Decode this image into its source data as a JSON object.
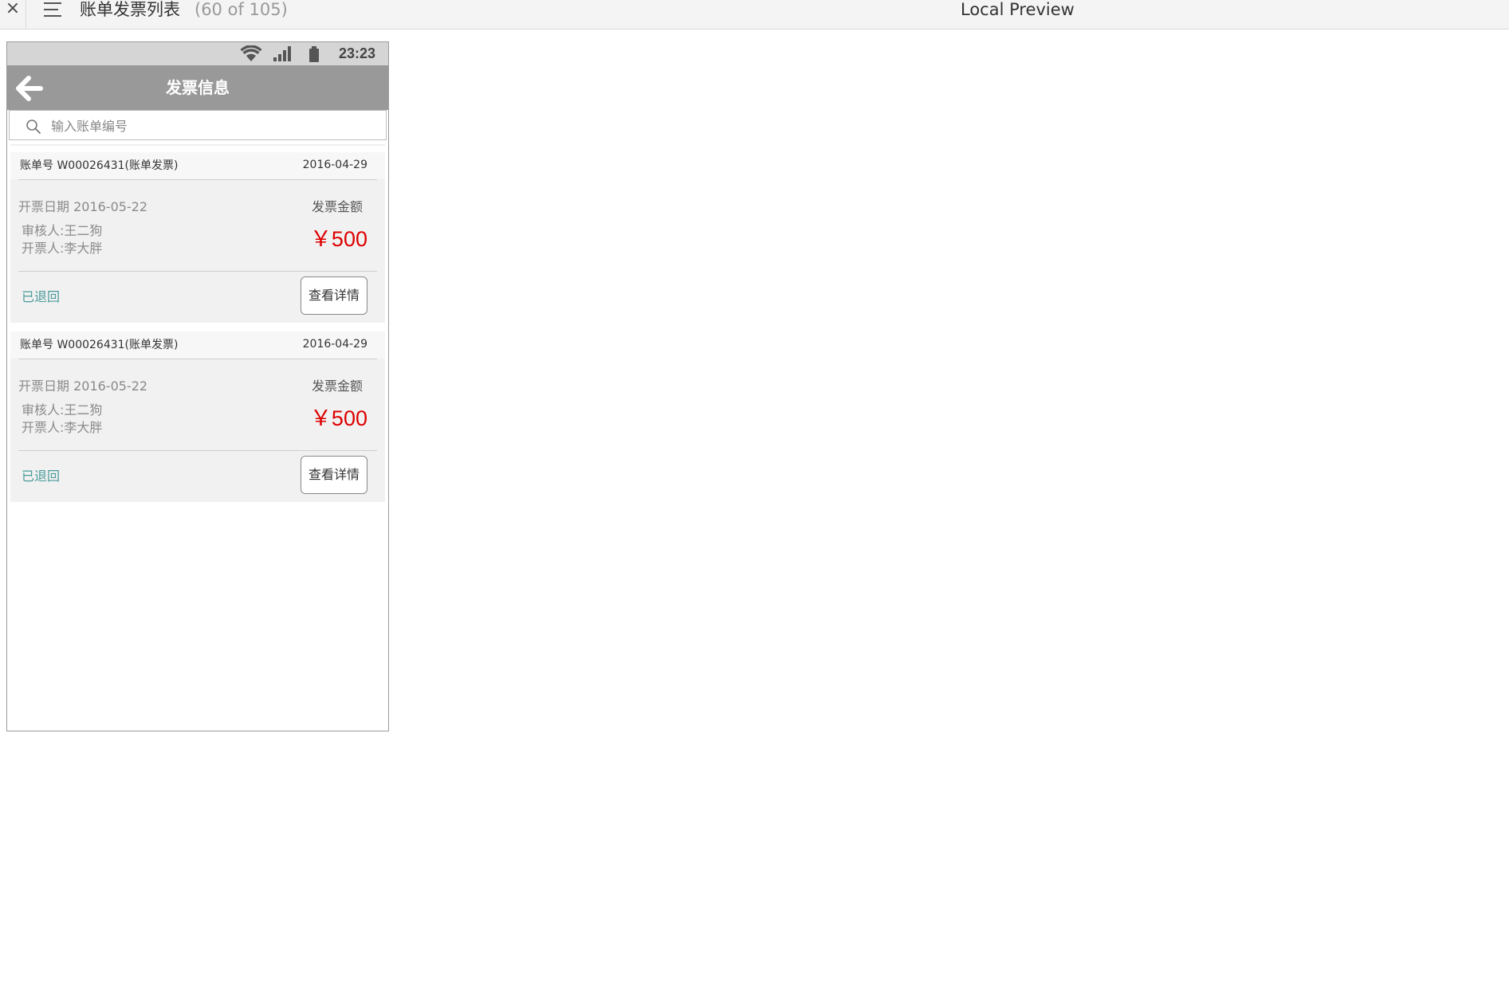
{
  "toolbar": {
    "close_glyph": "×",
    "page_title": "账单发票列表",
    "page_count": "(60 of 105)",
    "preview_label": "Local Preview"
  },
  "phone": {
    "status_time": "23:23",
    "nav_title": "发票信息",
    "search_placeholder": "输入账单编号",
    "invoices": [
      {
        "bill_label": "账单号  W00026431(账单发票)",
        "bill_date": "2016-04-29",
        "issue_date": "开票日期 2016-05-22",
        "auditor": "审核人:王二狗",
        "issuer": "开票人:李大胖",
        "amount_label": "发票金额",
        "amount": "￥500",
        "status": "已退回",
        "detail_button": "查看详情"
      },
      {
        "bill_label": "账单号  W00026431(账单发票)",
        "bill_date": "2016-04-29",
        "issue_date": "开票日期 2016-05-22",
        "auditor": "审核人:王二狗",
        "issuer": "开票人:李大胖",
        "amount_label": "发票金额",
        "amount": "￥500",
        "status": "已退回",
        "detail_button": "查看详情"
      }
    ]
  },
  "colors": {
    "nav_bar": "#999999",
    "amount": "#dd0000",
    "status": "#4b9a9a",
    "card_bg": "#f1f1f1"
  },
  "icons": [
    "close-icon",
    "menu-icon",
    "wifi-icon",
    "signal-icon",
    "battery-icon",
    "back-arrow-icon",
    "search-icon"
  ]
}
